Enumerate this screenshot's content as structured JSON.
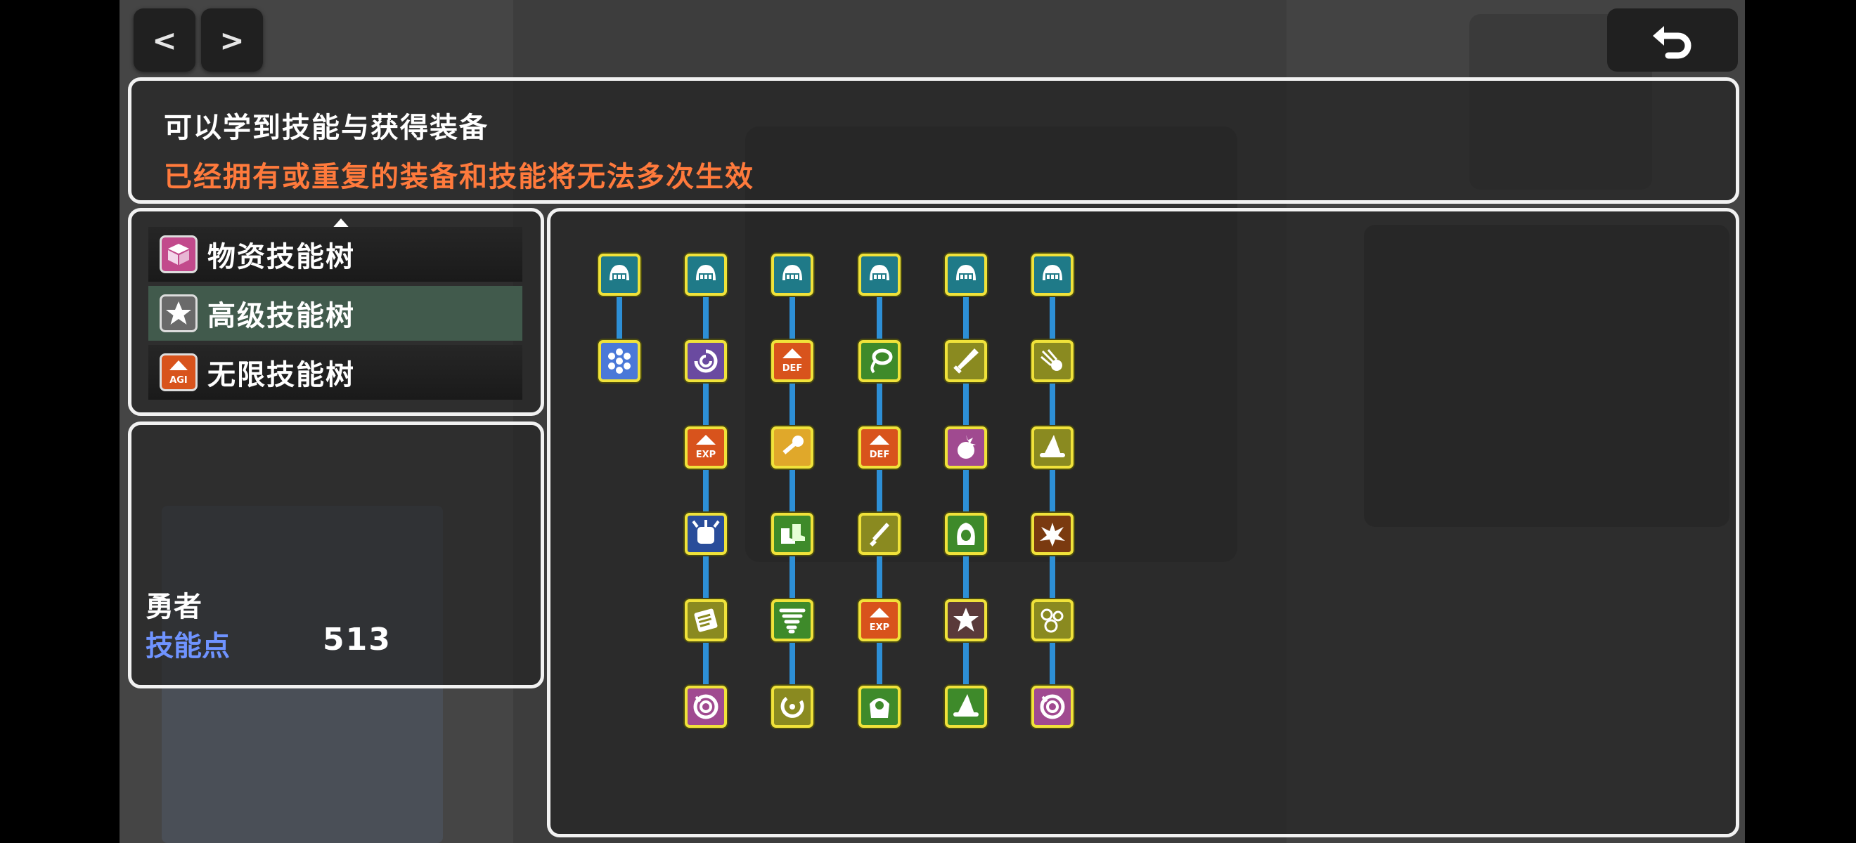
{
  "nav": {
    "prev_label": "<",
    "next_label": ">",
    "back_icon": "return-arrow-icon"
  },
  "info": {
    "line1": "可以学到技能与获得装备",
    "line2": "已经拥有或重复的装备和技能将无法多次生效",
    "line2_color": "#ff7a3c"
  },
  "trees": [
    {
      "label": "物资技能树",
      "icon": "supply-box-icon",
      "color": "#c24a8c"
    },
    {
      "label": "高级技能树",
      "icon": "star-icon",
      "color": "#6a6a6a"
    },
    {
      "label": "无限技能树",
      "icon": "agi-up-icon",
      "color": "#d8531c",
      "icon_text": "AGI"
    }
  ],
  "selected_tree_index": 1,
  "hero": {
    "name": "勇者",
    "skill_points_label": "技能点",
    "skill_points": "513"
  },
  "skill_grid": {
    "columns": [
      [
        {
          "icon": "helmet-icon",
          "bg": "#1f7a88"
        },
        {
          "icon": "snowflake-icon",
          "bg": "#4a78d8"
        }
      ],
      [
        {
          "icon": "helmet-icon",
          "bg": "#1f7a88"
        },
        {
          "icon": "vortex-icon",
          "bg": "#6a4aa0"
        },
        {
          "icon": "exp-up-icon",
          "bg": "#d8531c",
          "text": "EXP"
        },
        {
          "icon": "spiked-gauntlet-icon",
          "bg": "#2a4d9a"
        },
        {
          "icon": "scroll-icon",
          "bg": "#8a8a20"
        },
        {
          "icon": "magic-ring-icon",
          "bg": "#a04a90"
        }
      ],
      [
        {
          "icon": "helmet-icon",
          "bg": "#1f7a88"
        },
        {
          "icon": "def-up-icon",
          "bg": "#d8531c",
          "text": "DEF"
        },
        {
          "icon": "key-icon",
          "bg": "#e0a82a"
        },
        {
          "icon": "boots-icon",
          "bg": "#3e8a2a"
        },
        {
          "icon": "tornado-icon",
          "bg": "#3e8a2a"
        },
        {
          "icon": "swirl-icon",
          "bg": "#8a8a20"
        }
      ],
      [
        {
          "icon": "helmet-icon",
          "bg": "#1f7a88"
        },
        {
          "icon": "lasso-icon",
          "bg": "#3e8a2a"
        },
        {
          "icon": "def-up-icon",
          "bg": "#d8531c",
          "text": "DEF"
        },
        {
          "icon": "dagger-icon",
          "bg": "#8a8a20"
        },
        {
          "icon": "exp-up-icon",
          "bg": "#d8531c",
          "text": "EXP"
        },
        {
          "icon": "armor-icon",
          "bg": "#3e8a2a"
        }
      ],
      [
        {
          "icon": "helmet-icon",
          "bg": "#1f7a88"
        },
        {
          "icon": "sword-icon",
          "bg": "#8a8a20"
        },
        {
          "icon": "burst-icon",
          "bg": "#a04a90"
        },
        {
          "icon": "hood-icon",
          "bg": "#3e8a2a"
        },
        {
          "icon": "star-icon",
          "bg": "#5a3a3a"
        },
        {
          "icon": "wizard-hat-icon",
          "bg": "#3e8a2a"
        }
      ],
      [
        {
          "icon": "helmet-icon",
          "bg": "#1f7a88"
        },
        {
          "icon": "comet-icon",
          "bg": "#8a8a20"
        },
        {
          "icon": "wizard-hat-icon",
          "bg": "#8a8a20"
        },
        {
          "icon": "explosion-icon",
          "bg": "#7a3a10"
        },
        {
          "icon": "bubbles-icon",
          "bg": "#8a8a20"
        },
        {
          "icon": "magic-ring-icon",
          "bg": "#a04a90"
        }
      ]
    ]
  }
}
